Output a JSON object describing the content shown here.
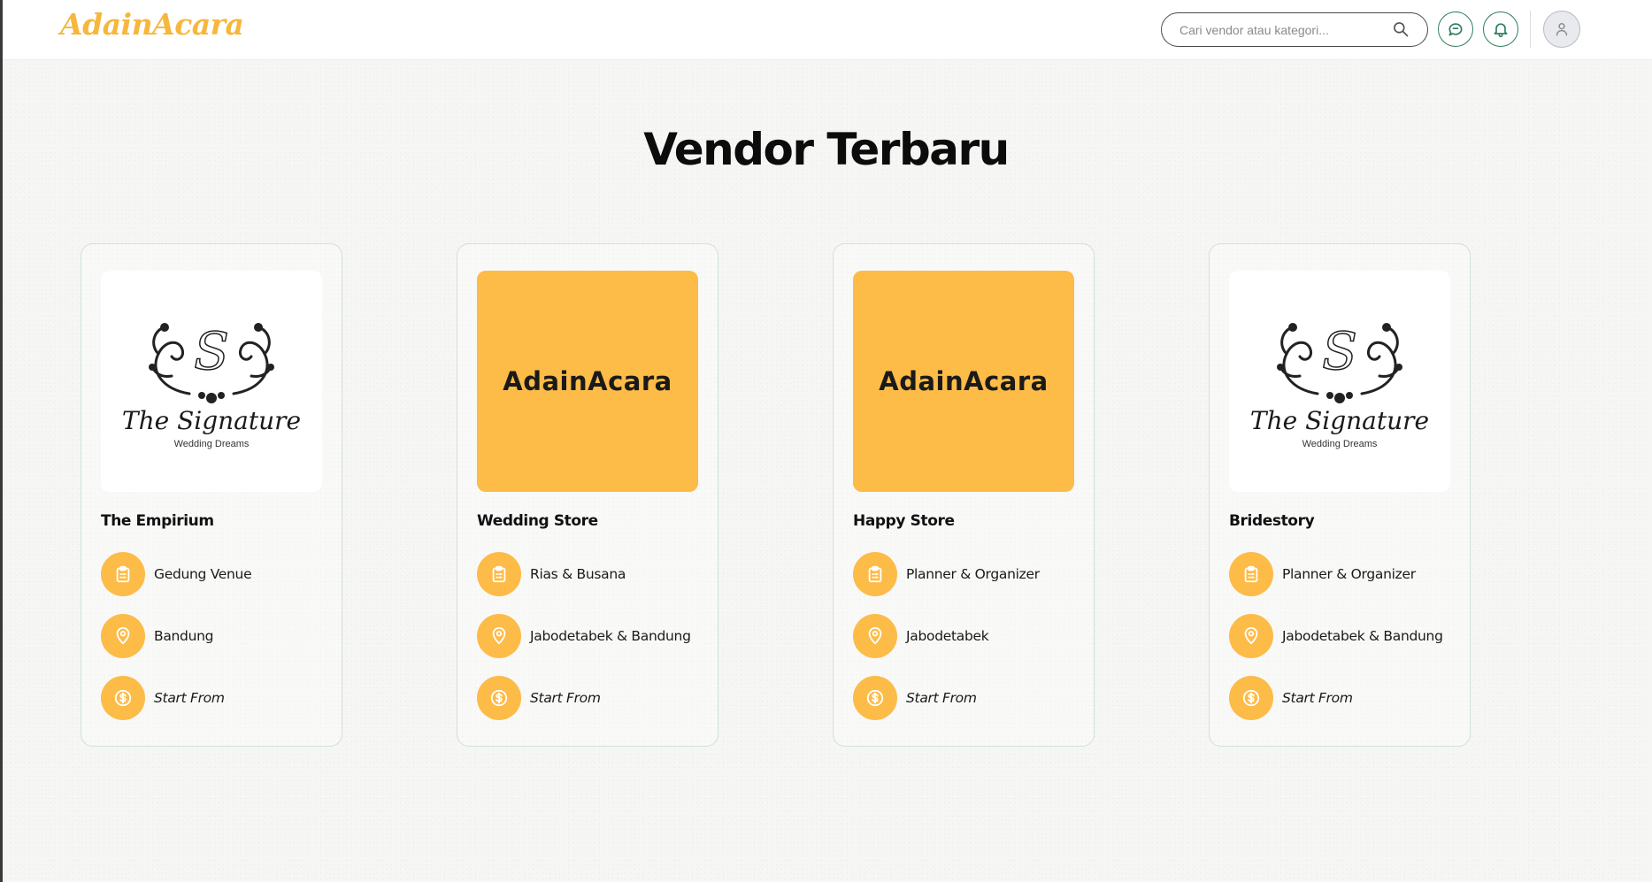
{
  "header": {
    "logo": "AdainAcara",
    "search_placeholder": "Cari vendor atau kategori...",
    "icons": [
      "search-icon",
      "chat-icon",
      "bell-icon",
      "user-avatar-icon"
    ]
  },
  "section_title": "Vendor Terbaru",
  "colors": {
    "accent": "#fdbb47",
    "logo": "#f6b73c",
    "icon_outline": "#2e7d5b",
    "card_border": "#cfe1dd"
  },
  "vendors": [
    {
      "name": "The Empirium",
      "image": {
        "type": "signature-logo",
        "script": "The Signature",
        "caption": "Wedding Dreams"
      },
      "category": "Gedung Venue",
      "location": "Bandung",
      "price": "Start From"
    },
    {
      "name": "Wedding Store",
      "image": {
        "type": "brand-logo",
        "text": "AdainAcara"
      },
      "category": "Rias & Busana",
      "location": "Jabodetabek & Bandung",
      "price": "Start From"
    },
    {
      "name": "Happy Store",
      "image": {
        "type": "brand-logo",
        "text": "AdainAcara"
      },
      "category": "Planner & Organizer",
      "location": "Jabodetabek",
      "price": "Start From"
    },
    {
      "name": "Bridestory",
      "image": {
        "type": "signature-logo",
        "script": "The Signature",
        "caption": "Wedding Dreams"
      },
      "category": "Planner & Organizer",
      "location": "Jabodetabek & Bandung",
      "price": "Start From"
    }
  ]
}
